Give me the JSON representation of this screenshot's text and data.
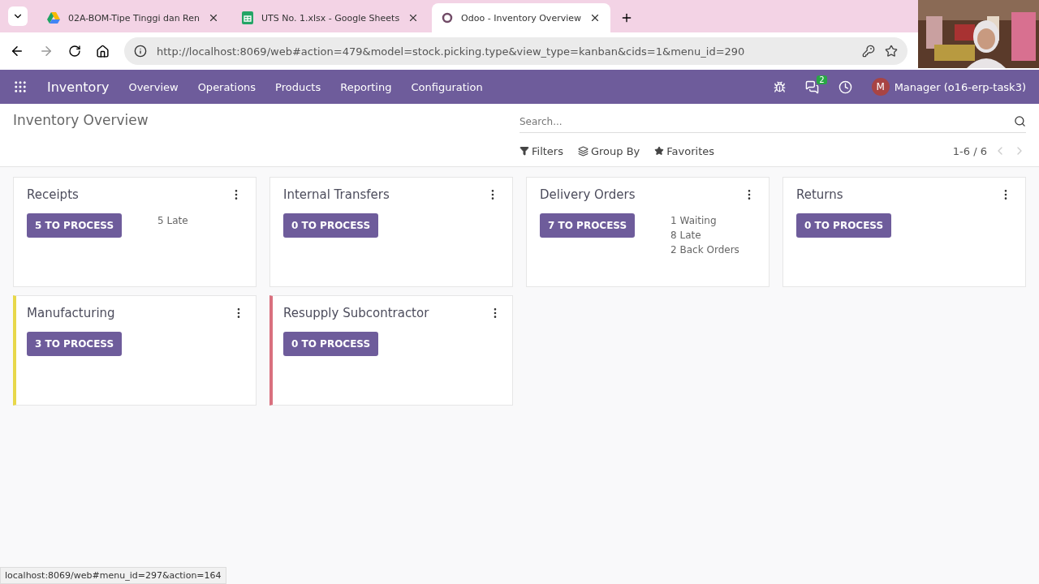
{
  "browser": {
    "tabs": [
      {
        "title": "02A-BOM-Tipe Tinggi dan Ren",
        "selected": false
      },
      {
        "title": "UTS No. 1.xlsx - Google Sheets",
        "selected": false
      },
      {
        "title": "Odoo - Inventory Overview",
        "selected": true
      }
    ],
    "url": "http://localhost:8069/web#action=479&model=stock.picking.type&view_type=kanban&cids=1&menu_id=290"
  },
  "navbar": {
    "app": "Inventory",
    "menu": [
      "Overview",
      "Operations",
      "Products",
      "Reporting",
      "Configuration"
    ],
    "messages_badge": "2",
    "user_initial": "M",
    "user": "Manager (o16-erp-task3)"
  },
  "control_panel": {
    "title": "Inventory Overview",
    "search": {
      "placeholder": "Search..."
    },
    "filters": [
      "Filters",
      "Group By",
      "Favorites"
    ],
    "pager": "1-6 / 6"
  },
  "cards": [
    {
      "title": "Receipts",
      "action": "5 TO PROCESS",
      "stats": [
        "5 Late"
      ]
    },
    {
      "title": "Internal Transfers",
      "action": "0 TO PROCESS"
    },
    {
      "title": "Delivery Orders",
      "action": "7 TO PROCESS",
      "stats": [
        "1 Waiting",
        "8 Late",
        "2 Back Orders"
      ]
    },
    {
      "title": "Returns",
      "action": "0 TO PROCESS"
    },
    {
      "title": "Manufacturing",
      "action": "3 TO PROCESS",
      "color": "#e8d84a"
    },
    {
      "title": "Resupply Subcontractor",
      "action": "0 TO PROCESS",
      "color": "#d9707e"
    }
  ],
  "status_bar": "localhost:8069/web#menu_id=297&action=164"
}
